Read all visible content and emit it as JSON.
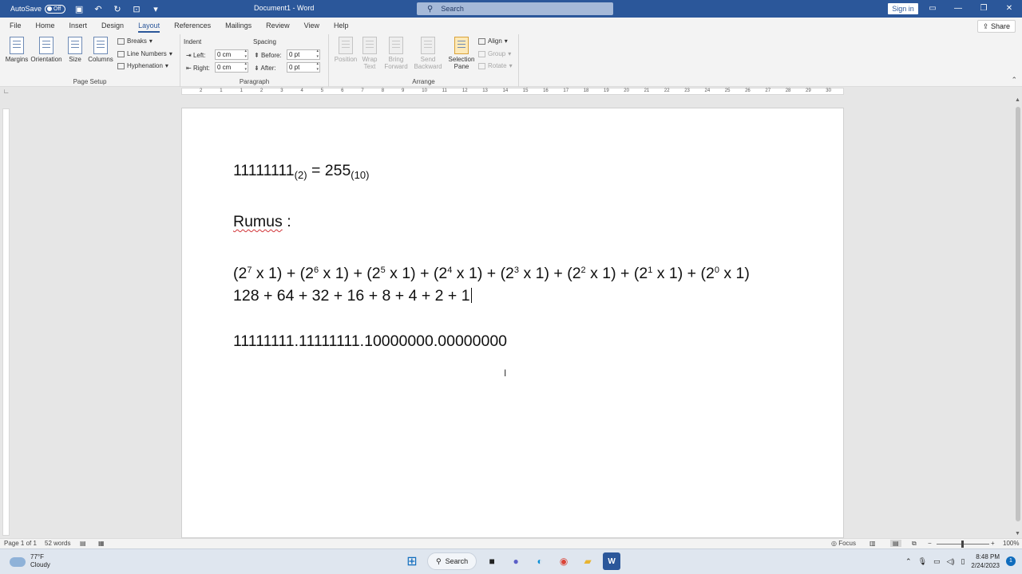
{
  "titlebar": {
    "autosave_label": "AutoSave",
    "autosave_state": "Off",
    "document_title": "Document1 - Word",
    "search_placeholder": "Search",
    "signin_label": "Sign in"
  },
  "tabs": [
    "File",
    "Home",
    "Insert",
    "Design",
    "Layout",
    "References",
    "Mailings",
    "Review",
    "View",
    "Help"
  ],
  "active_tab": "Layout",
  "share_label": "Share",
  "ribbon": {
    "page_setup": {
      "label": "Page Setup",
      "margins": "Margins",
      "orientation": "Orientation",
      "size": "Size",
      "columns": "Columns",
      "breaks": "Breaks",
      "line_numbers": "Line Numbers",
      "hyphenation": "Hyphenation"
    },
    "paragraph": {
      "label": "Paragraph",
      "indent_label": "Indent",
      "spacing_label": "Spacing",
      "left_label": "Left:",
      "left_value": "0 cm",
      "right_label": "Right:",
      "right_value": "0 cm",
      "before_label": "Before:",
      "before_value": "0 pt",
      "after_label": "After:",
      "after_value": "0 pt"
    },
    "arrange": {
      "label": "Arrange",
      "position": "Position",
      "wrap_text": [
        "Wrap",
        "Text"
      ],
      "bring_forward": [
        "Bring",
        "Forward"
      ],
      "send_backward": [
        "Send",
        "Backward"
      ],
      "selection_pane": [
        "Selection",
        "Pane"
      ],
      "align": "Align",
      "group": "Group",
      "rotate": "Rotate"
    }
  },
  "ruler_ticks": [
    "2",
    "1",
    "1",
    "2",
    "3",
    "4",
    "5",
    "6",
    "7",
    "8",
    "9",
    "10",
    "11",
    "12",
    "13",
    "14",
    "15",
    "16",
    "17",
    "18",
    "19",
    "20",
    "21",
    "22",
    "23",
    "24",
    "25",
    "26",
    "27",
    "28",
    "29",
    "30"
  ],
  "document": {
    "line1": {
      "main1": "11111111",
      "sub1": "(2)",
      "mid": " = 255",
      "sub2": "(10)"
    },
    "rumus": "Rumus",
    "rumus_colon": " :",
    "formula_terms": [
      {
        "open": "(2",
        "exp": "7",
        "close": " x 1)"
      },
      {
        "open": "(2",
        "exp": "6",
        "close": " x 1)"
      },
      {
        "open": "(2",
        "exp": "5",
        "close": " x 1)"
      },
      {
        "open": "(2",
        "exp": "4",
        "close": " x 1)"
      },
      {
        "open": "(2",
        "exp": "3",
        "close": " x 1)"
      },
      {
        "open": "(2",
        "exp": "2",
        "close": " x 1)"
      },
      {
        "open": "(2",
        "exp": "1",
        "close": " x 1)"
      },
      {
        "open": "(2",
        "exp": "0",
        "close": " x 1)"
      }
    ],
    "plus": " + ",
    "sum_line": "128 + 64 + 32 + 16 + 8 + 4 + 2 + 1",
    "binary_ip": "11111111.11111111.10000000.00000000"
  },
  "statusbar": {
    "page": "Page 1 of 1",
    "words": "52 words",
    "focus": "Focus",
    "zoom": "100%"
  },
  "taskbar": {
    "temperature": "77°F",
    "weather": "Cloudy",
    "search_label": "Search",
    "time": "8:48 PM",
    "date": "2/24/2023",
    "notifications": "1"
  },
  "colors": {
    "word_blue": "#2b579a",
    "spell_error": "#d13438"
  }
}
